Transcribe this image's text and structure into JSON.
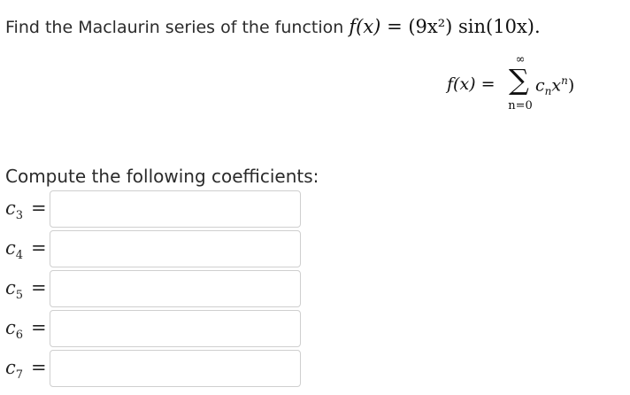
{
  "problem": {
    "prompt_text": "Find the Maclaurin series of the function",
    "function_lhs": "f(x)",
    "function_rhs": "= (9x²) sin(10x)."
  },
  "series": {
    "lhs": "f(x) =",
    "sum_upper": "∞",
    "sum_symbol": "∑",
    "sum_lower": "n=0",
    "term_coeff": "c",
    "term_coeff_sub": "n",
    "term_var": "x",
    "term_exp": "n",
    "closing": ")"
  },
  "compute_label": "Compute the following coefficients:",
  "coefficients": [
    {
      "symbol": "c",
      "index": "3",
      "eq": "=",
      "value": ""
    },
    {
      "symbol": "c",
      "index": "4",
      "eq": "=",
      "value": ""
    },
    {
      "symbol": "c",
      "index": "5",
      "eq": "=",
      "value": ""
    },
    {
      "symbol": "c",
      "index": "6",
      "eq": "=",
      "value": ""
    },
    {
      "symbol": "c",
      "index": "7",
      "eq": "=",
      "value": ""
    }
  ]
}
